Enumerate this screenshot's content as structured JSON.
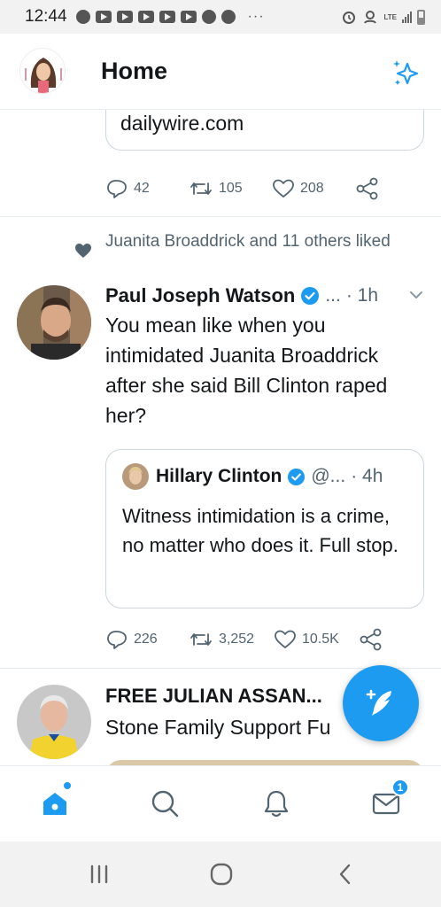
{
  "status_bar": {
    "time": "12:44",
    "dots": "···",
    "network": "LTE"
  },
  "header": {
    "title": "Home"
  },
  "feed": {
    "prev_card": {
      "domain": "dailywire.com"
    },
    "prev_actions": {
      "replies": "42",
      "retweets": "105",
      "likes": "208"
    },
    "tweet": {
      "social_context": "Juanita Broaddrick and 11 others liked",
      "author": "Paul Joseph Watson",
      "handle": "...",
      "time": "· 1h",
      "text": "You mean like when you intimidated Juanita Broaddrick after she said Bill Clinton raped her?",
      "quote": {
        "author": "Hillary Clinton",
        "handle": "@...",
        "time": "· 4h",
        "text": "Witness intimidation is a crime, no matter who does it. Full stop."
      },
      "actions": {
        "replies": "226",
        "retweets": "3,252",
        "likes": "10.5K"
      }
    },
    "next_tweet": {
      "author": "FREE JULIAN ASSAN...",
      "text": "Stone Family Support Fu"
    }
  },
  "bottom_nav": {
    "messages_badge": "1"
  },
  "colors": {
    "accent": "#1d9bf0",
    "text": "#14171a",
    "muted": "#536471",
    "border": "#e6ecf0"
  }
}
